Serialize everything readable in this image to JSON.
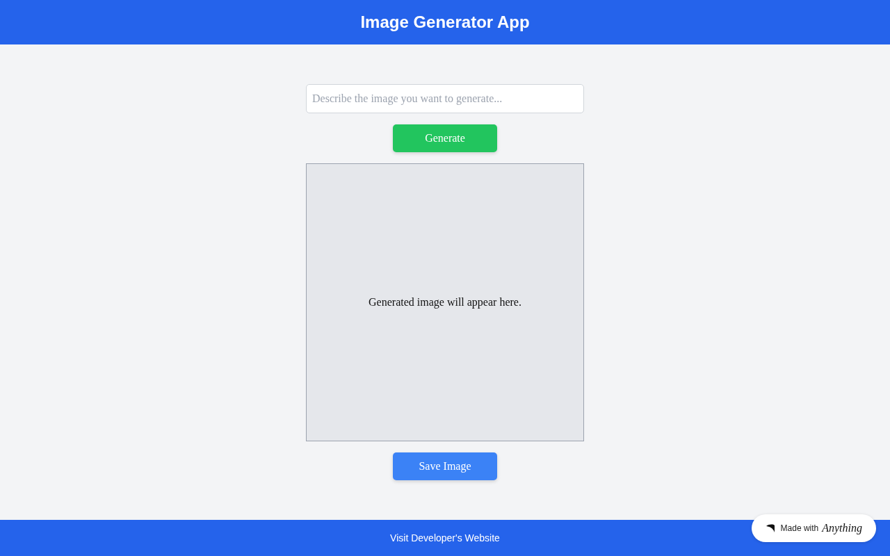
{
  "header": {
    "title": "Image Generator App"
  },
  "prompt": {
    "placeholder": "Describe the image you want to generate..."
  },
  "generate_button": "Generate",
  "image_area": {
    "message": "Generated image will appear here."
  },
  "save_button": "Save Image",
  "footer": {
    "link": "Visit Developer's Website"
  },
  "badge": {
    "prefix": "Made with",
    "brand": "Anything"
  }
}
